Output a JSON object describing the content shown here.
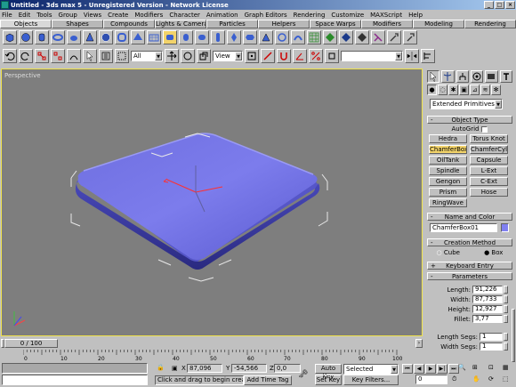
{
  "window": {
    "title": "Untitled - 3ds max 5 - Unregistered Version - Network License",
    "accent": "#0a246a"
  },
  "menu": [
    "File",
    "Edit",
    "Tools",
    "Group",
    "Views",
    "Create",
    "Modifiers",
    "Character",
    "Animation",
    "Graph Editors",
    "Rendering",
    "Customize",
    "MAXScript",
    "Help"
  ],
  "tabs": [
    {
      "label": "Objects",
      "active": true
    },
    {
      "label": "Shapes"
    },
    {
      "label": "Compounds"
    },
    {
      "label": "Lights & Cameras"
    },
    {
      "label": "Particles"
    },
    {
      "label": "Helpers"
    },
    {
      "label": "Space Warps"
    },
    {
      "label": "Modifiers"
    },
    {
      "label": "Modeling"
    },
    {
      "label": "Rendering"
    }
  ],
  "toolbar": {
    "selection_filter": "All",
    "ref_coord": "View"
  },
  "viewport": {
    "label": "Perspective",
    "background": "#7e7e7e",
    "object_color": "#7a7ae8"
  },
  "time": {
    "slider": "0 / 100",
    "ticks": [
      "0",
      "10",
      "20",
      "30",
      "40",
      "50",
      "60",
      "70",
      "80",
      "90",
      "100"
    ]
  },
  "status": {
    "coord_x_label": "X",
    "coord_x": "87,096",
    "coord_y_label": "Y",
    "coord_y": "-54,566",
    "coord_z_label": "Z",
    "coord_z": "0,0",
    "prompt": "Click and drag to begin creation pr",
    "add_time_tag": "Add Time Tag",
    "auto_key": "Auto Key",
    "set_key": "Set Key",
    "key_mode": "Selected",
    "key_filters": "Key Filters...",
    "frame": "0"
  },
  "panel": {
    "category": "Extended Primitives",
    "object_type": {
      "title": "Object Type",
      "autogrid": "AutoGrid",
      "buttons": [
        [
          "Hedra",
          "Torus Knot"
        ],
        [
          "ChamferBox",
          "ChamferCyl"
        ],
        [
          "OilTank",
          "Capsule"
        ],
        [
          "Spindle",
          "L-Ext"
        ],
        [
          "Gengon",
          "C-Ext"
        ],
        [
          "Prism",
          "Hose"
        ],
        [
          "RingWave",
          ""
        ]
      ],
      "active": "ChamferBox"
    },
    "name_color": {
      "title": "Name and Color",
      "name": "ChamferBox01",
      "color": "#8080f0"
    },
    "creation_method": {
      "title": "Creation Method",
      "cube": "Cube",
      "box": "Box",
      "selected": "Box"
    },
    "keyboard_entry": {
      "title": "Keyboard Entry"
    },
    "parameters": {
      "title": "Parameters",
      "fields": [
        {
          "label": "Length:",
          "value": "91,226"
        },
        {
          "label": "Width:",
          "value": "87,733"
        },
        {
          "label": "Height:",
          "value": "12,927"
        },
        {
          "label": "Fillet:",
          "value": "3,77"
        }
      ],
      "segs": [
        {
          "label": "Length Segs:",
          "value": "1"
        },
        {
          "label": "Width Segs:",
          "value": "1"
        }
      ]
    }
  }
}
